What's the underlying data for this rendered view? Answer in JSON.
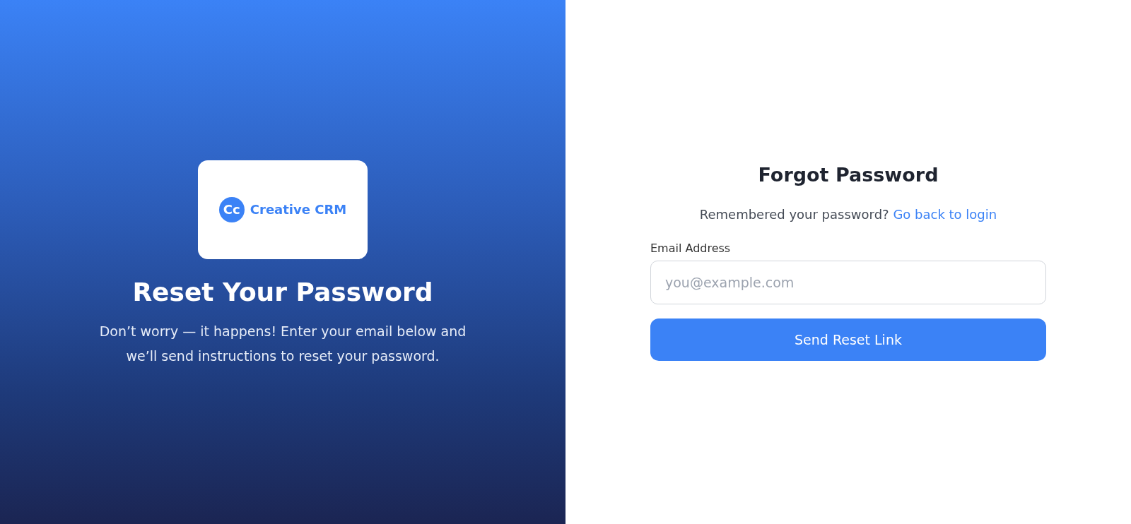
{
  "brand": {
    "logo_mark": "Cc",
    "logo_text": "Creative CRM"
  },
  "hero": {
    "title": "Reset Your Password",
    "description": "Don’t worry — it happens! Enter your email below and we’ll send instructions to reset your password."
  },
  "form": {
    "title": "Forgot Password",
    "prompt": "Remembered your password?",
    "link": "Go back to login",
    "email_label": "Email Address",
    "email_placeholder": "you@example.com",
    "submit": "Send Reset Link"
  }
}
